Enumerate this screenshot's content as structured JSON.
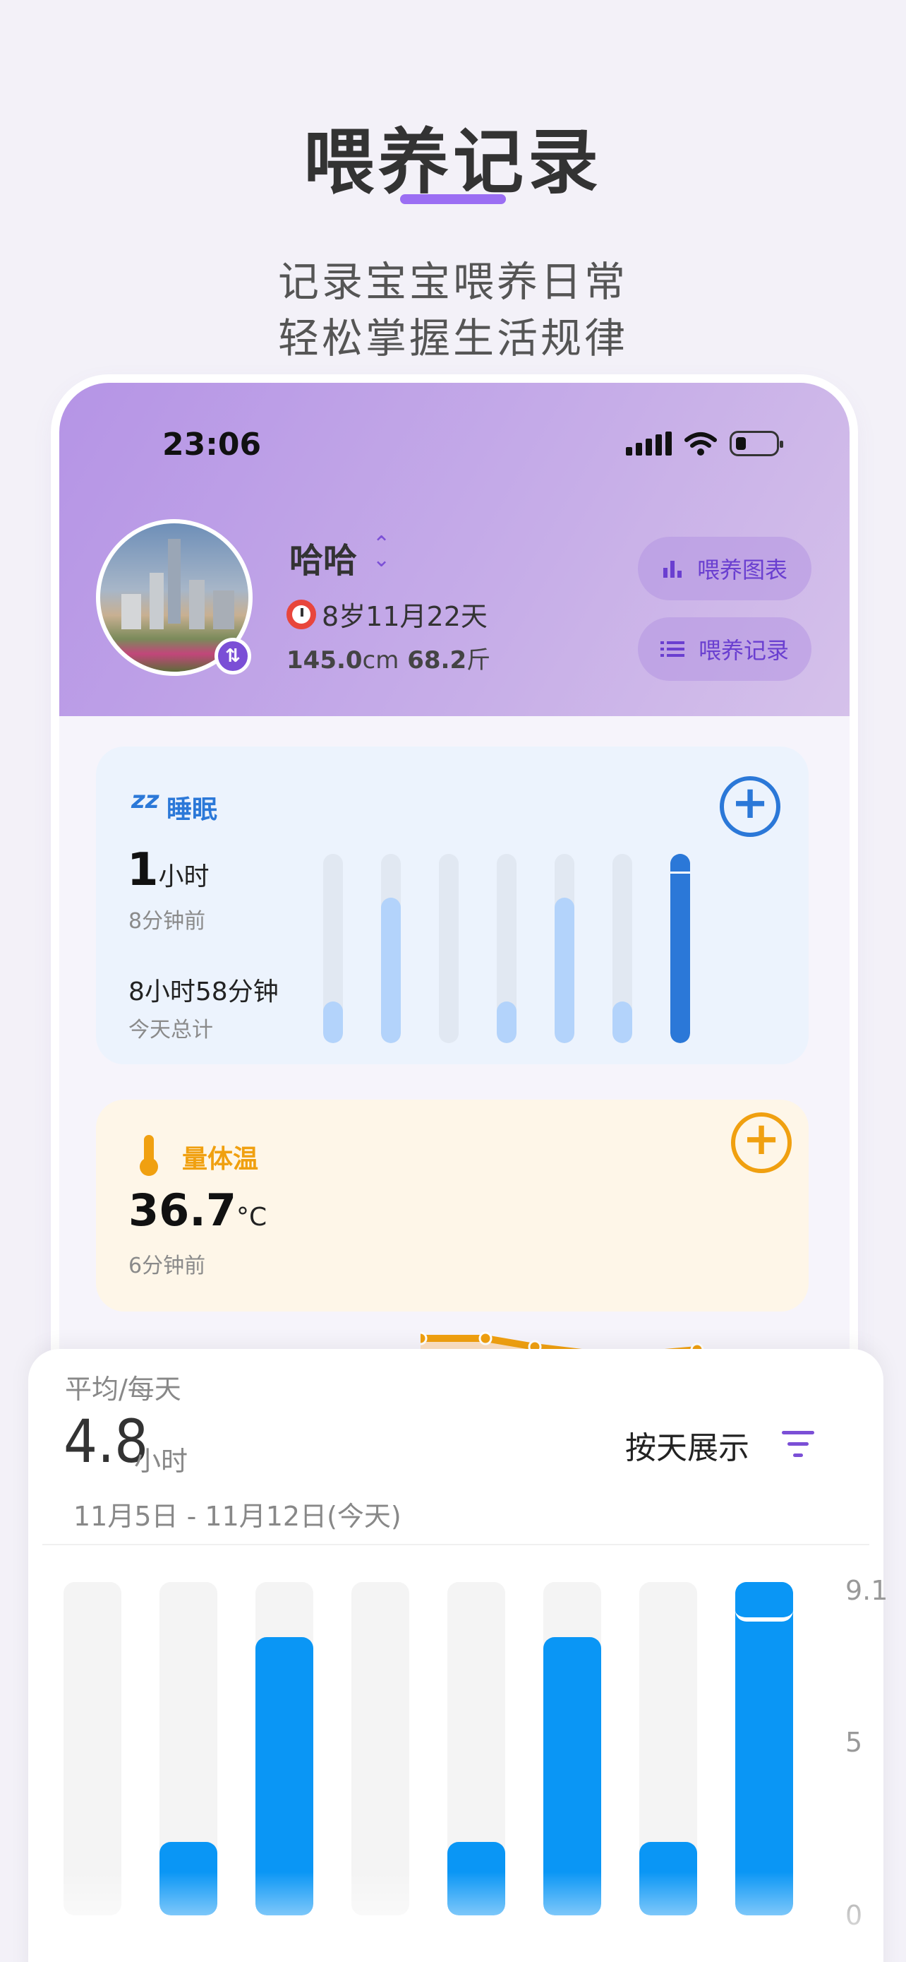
{
  "hero": {
    "title": "喂养记录",
    "subtitle_line1": "记录宝宝喂养日常",
    "subtitle_line2": "轻松掌握生活规律"
  },
  "status_bar": {
    "time": "23:06",
    "icons": [
      "signal-icon",
      "wifi-icon",
      "battery-icon"
    ]
  },
  "profile": {
    "name": "哈哈",
    "age": "8岁11月22天",
    "height_value": "145.0",
    "height_unit": "cm",
    "weight_value": "68.2",
    "weight_unit": "斤"
  },
  "actions": {
    "chart_label": "喂养图表",
    "records_label": "喂养记录"
  },
  "sleep_card": {
    "title": "睡眠",
    "last_value": "1",
    "last_unit": "小时",
    "last_ago": "8分钟前",
    "total_value": "8小时58分钟",
    "total_label": "今天总计",
    "bar_levels": [
      0.22,
      0.77,
      0.0,
      0.22,
      0.77,
      0.22,
      1.0
    ],
    "accent": "#2b78d8"
  },
  "temp_card": {
    "title": "量体温",
    "value": "36.7",
    "unit": "°C",
    "ago": "6分钟前",
    "accent": "#f0a010"
  },
  "summary": {
    "avg_label": "平均/每天",
    "avg_value": "4.8",
    "avg_unit": "小时",
    "view_mode": "按天展示",
    "date_range": "11月5日 - 11月12日(今天)"
  },
  "chart_data": {
    "type": "bar",
    "title": "",
    "xlabel": "",
    "ylabel": "",
    "ylim": [
      0,
      9.1
    ],
    "y_ticks": [
      "9.1",
      "5",
      "0"
    ],
    "categories": [
      "",
      "",
      "",
      "",
      "",
      "",
      "",
      ""
    ],
    "values": [
      0,
      2,
      7.6,
      0,
      2,
      7.6,
      2,
      9.1
    ],
    "color": "#0a96f5",
    "grid": false
  }
}
